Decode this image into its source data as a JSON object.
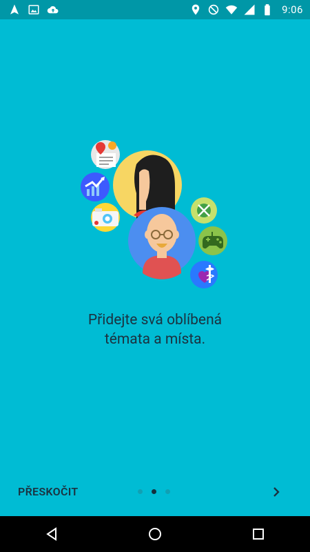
{
  "status_bar": {
    "time": "9:06",
    "left_icons": [
      "navigation-icon",
      "image-icon",
      "cloud-upload-icon"
    ],
    "right_icons": [
      "location-icon",
      "do-not-disturb-icon",
      "wifi-icon",
      "signal-icon",
      "battery-icon"
    ]
  },
  "onboarding": {
    "caption_line1": "Přidejte svá oblíbená",
    "caption_line2": "témata a místa.",
    "skip_label": "PŘESKOČIT",
    "page_indicator": {
      "total": 3,
      "active": 2
    }
  },
  "colors": {
    "background": "#00BCD4",
    "status_bar": "#0097A7",
    "text": "#1B3240",
    "dot_active": "#13303E",
    "dot_inactive": "#11A0B3"
  },
  "nav_bar": {
    "buttons": [
      "back-icon",
      "home-icon",
      "recents-icon"
    ]
  }
}
